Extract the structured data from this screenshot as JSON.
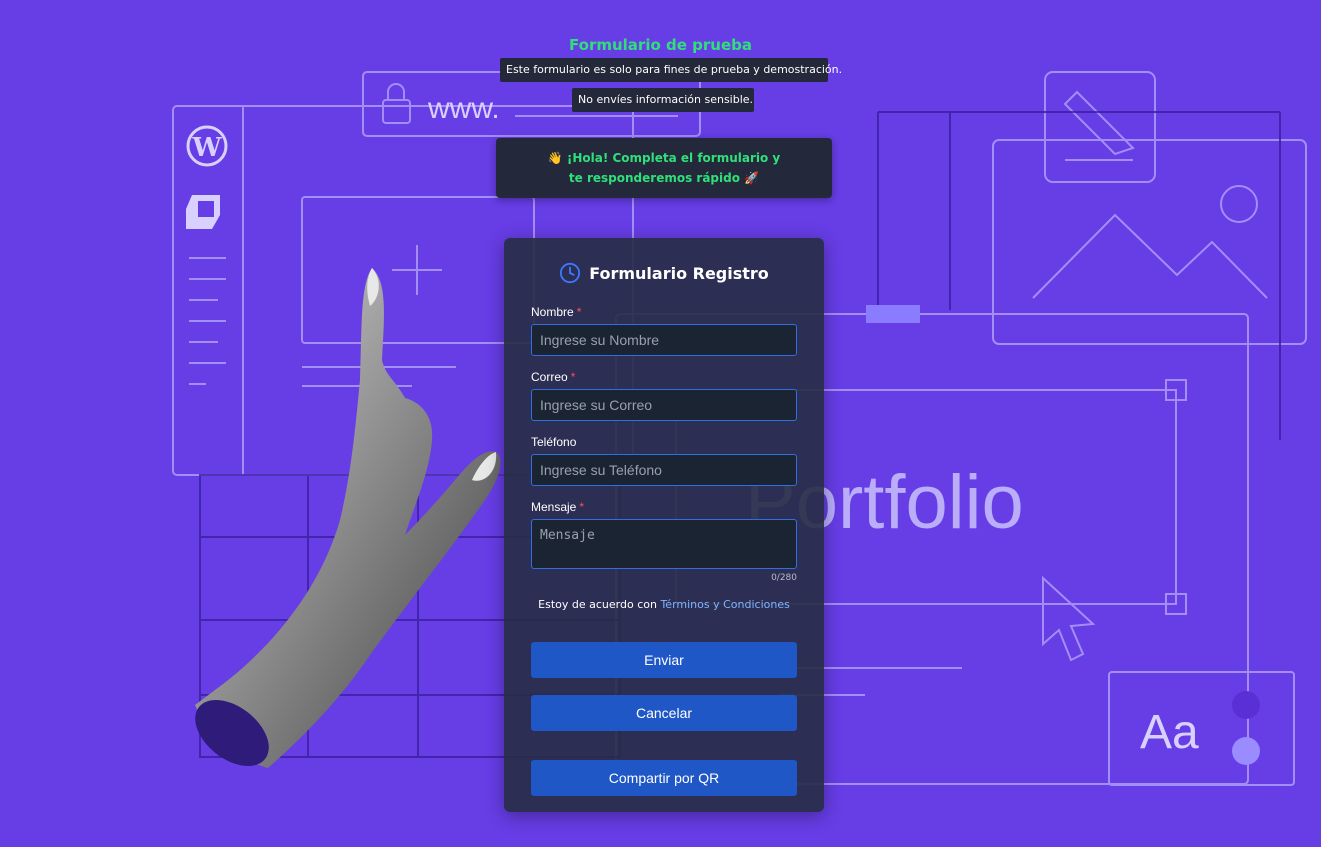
{
  "header": {
    "title": "Formulario de prueba",
    "notice_1": "Este formulario es solo para fines de prueba y demostración.",
    "notice_2": "No envíes información sensible."
  },
  "greeting": {
    "text": "👋 ¡Hola! Completa el formulario y te respondere​mos rápido 🚀"
  },
  "background": {
    "url_text": "www.",
    "portfolio_text": "Portfolio",
    "font_sample": "Aa"
  },
  "form": {
    "title": "Formulario Registro",
    "fields": {
      "name": {
        "label": "Nombre",
        "required_mark": "*",
        "placeholder": "Ingrese su Nombre"
      },
      "email": {
        "label": "Correo",
        "required_mark": "*",
        "placeholder": "Ingrese su Correo"
      },
      "phone": {
        "label": "Teléfono",
        "placeholder": "Ingrese su Teléfono"
      },
      "message": {
        "label": "Mensaje",
        "required_mark": "*",
        "placeholder": "Mensaje",
        "counter": "0/280"
      }
    },
    "terms_prefix": "Estoy de acuerdo con",
    "terms_link": "Términos y Condiciones",
    "buttons": {
      "submit": "Enviar",
      "cancel": "Cancelar",
      "share_qr": "Compartir por QR"
    }
  },
  "colors": {
    "background": "#673de6",
    "accent_green": "#2fe07a",
    "button_blue": "#1f57c6",
    "required_red": "#ff4d5e"
  }
}
